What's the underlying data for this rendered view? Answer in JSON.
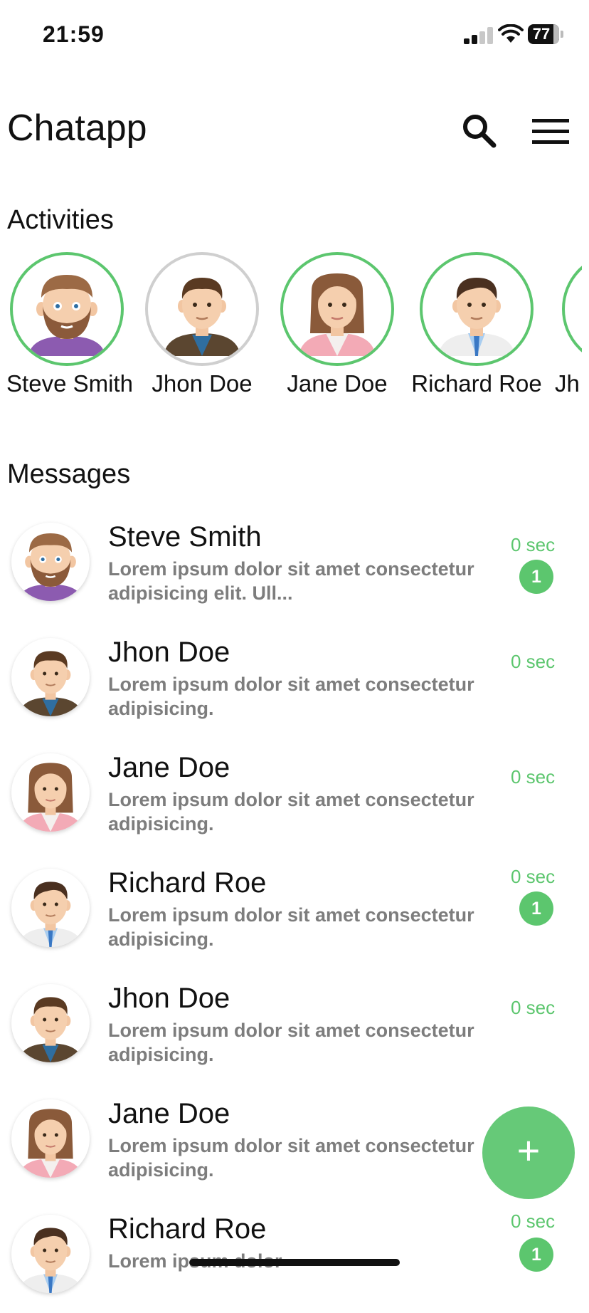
{
  "status_bar": {
    "time": "21:59",
    "battery": "77"
  },
  "header": {
    "title": "Chatapp",
    "search_icon": "search-icon",
    "menu_icon": "hamburger-menu-icon"
  },
  "activities": {
    "title": "Activities",
    "items": [
      {
        "name": "Steve Smith",
        "status": "active"
      },
      {
        "name": "Jhon Doe",
        "status": "inactive"
      },
      {
        "name": "Jane Doe",
        "status": "active"
      },
      {
        "name": "Richard Roe",
        "status": "active"
      },
      {
        "name": "Jh",
        "status": "active"
      }
    ]
  },
  "messages": {
    "title": "Messages",
    "items": [
      {
        "name": "Steve Smith",
        "preview": "Lorem ipsum dolor sit amet consectetur adipisicing elit. Ull...",
        "time": "0 sec",
        "unread": "1"
      },
      {
        "name": "Jhon Doe",
        "preview": "Lorem ipsum dolor sit amet consectetur adipisicing.",
        "time": "0 sec",
        "unread": null
      },
      {
        "name": "Jane Doe",
        "preview": "Lorem ipsum dolor sit amet consectetur adipisicing.",
        "time": "0 sec",
        "unread": null
      },
      {
        "name": "Richard Roe",
        "preview": "Lorem ipsum dolor sit amet consectetur adipisicing.",
        "time": "0 sec",
        "unread": "1"
      },
      {
        "name": "Jhon Doe",
        "preview": "Lorem ipsum dolor sit amet consectetur adipisicing.",
        "time": "0 sec",
        "unread": null
      },
      {
        "name": "Jane Doe",
        "preview": "Lorem ipsum dolor sit amet consectetur adipisicing.",
        "time": "",
        "unread": null
      },
      {
        "name": "Richard Roe",
        "preview": "Lorem ipsum dolor",
        "time": "0 sec",
        "unread": "1"
      }
    ]
  },
  "fab": {
    "label": "+"
  },
  "colors": {
    "accent": "#5cc66e",
    "muted_text": "#7d7d7d",
    "inactive_ring": "#cfcfcf"
  }
}
